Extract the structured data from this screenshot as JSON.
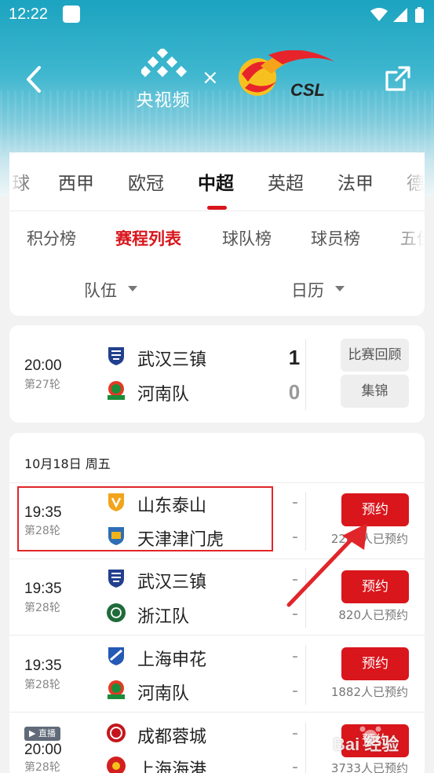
{
  "status_bar": {
    "time": "12:22"
  },
  "header": {
    "cctv_text": "央视频",
    "times_mark": "×",
    "csl_text": "CSL"
  },
  "league_tabs": [
    {
      "label": "球",
      "active": false
    },
    {
      "label": "西甲",
      "active": false
    },
    {
      "label": "欧冠",
      "active": false
    },
    {
      "label": "中超",
      "active": true
    },
    {
      "label": "英超",
      "active": false
    },
    {
      "label": "法甲",
      "active": false
    },
    {
      "label": "德",
      "active": false
    }
  ],
  "sub_tabs": [
    {
      "label": "积分榜",
      "active": false
    },
    {
      "label": "赛程列表",
      "active": true
    },
    {
      "label": "球队榜",
      "active": false
    },
    {
      "label": "球员榜",
      "active": false
    },
    {
      "label": "五佳",
      "active": false
    }
  ],
  "filters": {
    "team": "队伍",
    "calendar": "日历"
  },
  "result_match": {
    "time": "20:00",
    "round": "第27轮",
    "home": {
      "name": "武汉三镇",
      "score": "1"
    },
    "away": {
      "name": "河南队",
      "score": "0"
    },
    "replay_label": "比赛回顾",
    "highlights_label": "集锦"
  },
  "date_header": "10月18日 周五",
  "upcoming": [
    {
      "time": "19:35",
      "round": "第28轮",
      "home": "山东泰山",
      "away": "天津津门虎",
      "home_dash": "-",
      "away_dash": "-",
      "button": "预约",
      "count": "2283人已预约"
    },
    {
      "time": "19:35",
      "round": "第28轮",
      "home": "武汉三镇",
      "away": "浙江队",
      "home_dash": "-",
      "away_dash": "-",
      "button": "预约",
      "count": "820人已预约"
    },
    {
      "time": "19:35",
      "round": "第28轮",
      "home": "上海申花",
      "away": "河南队",
      "home_dash": "-",
      "away_dash": "-",
      "button": "预约",
      "count": "1882人已预约"
    },
    {
      "time": "20:00",
      "round": "第28轮",
      "live": "▶ 直播",
      "home": "成都蓉城",
      "away": "上海海港",
      "home_dash": "-",
      "away_dash": "-",
      "button": "预约",
      "count": "3733人已预约"
    }
  ],
  "watermark": "Bai 经验",
  "colors": {
    "accent": "#d8161c",
    "header_top": "#1ba3c0"
  }
}
